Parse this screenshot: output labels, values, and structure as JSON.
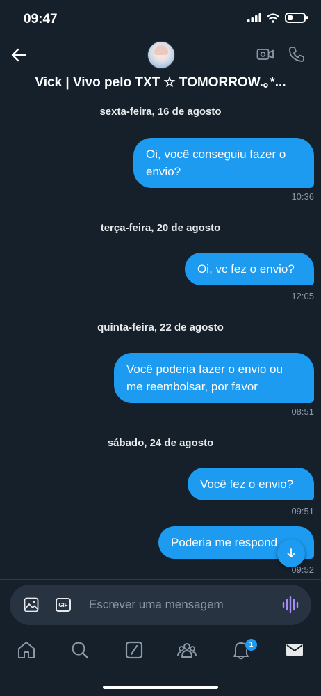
{
  "status": {
    "time": "09:47",
    "battery_level": 0.3
  },
  "header": {
    "contact_name": "Vick | Vivo pelo TXT ☆ TOMORROW.｡*..."
  },
  "messages": [
    {
      "date": "sexta-feira, 16 de agosto",
      "text": "Oi, você conseguiu fazer o envio?",
      "time": "10:36"
    },
    {
      "date": "terça-feira, 20 de agosto",
      "text": "Oi, vc fez o envio?",
      "time": "12:05"
    },
    {
      "date": "quinta-feira, 22 de agosto",
      "text": "Você poderia fazer o envio ou me reembolsar, por favor",
      "time": "08:51"
    },
    {
      "date": "sábado, 24 de agosto",
      "text": "Você fez o envio?",
      "time": "09:51"
    },
    {
      "date": "",
      "text": "Poderia me respond",
      "time": "09:52"
    }
  ],
  "composer": {
    "placeholder": "Escrever uma mensagem",
    "gif_label": "GIF"
  },
  "tabs": {
    "icons": [
      "home-icon",
      "search-icon",
      "grok-icon",
      "communities-icon",
      "notifications-icon",
      "messages-icon"
    ],
    "notification_count": "1"
  },
  "colors": {
    "background": "#15202b",
    "accent": "#1d9bf0",
    "voice": "#a78bfa"
  }
}
